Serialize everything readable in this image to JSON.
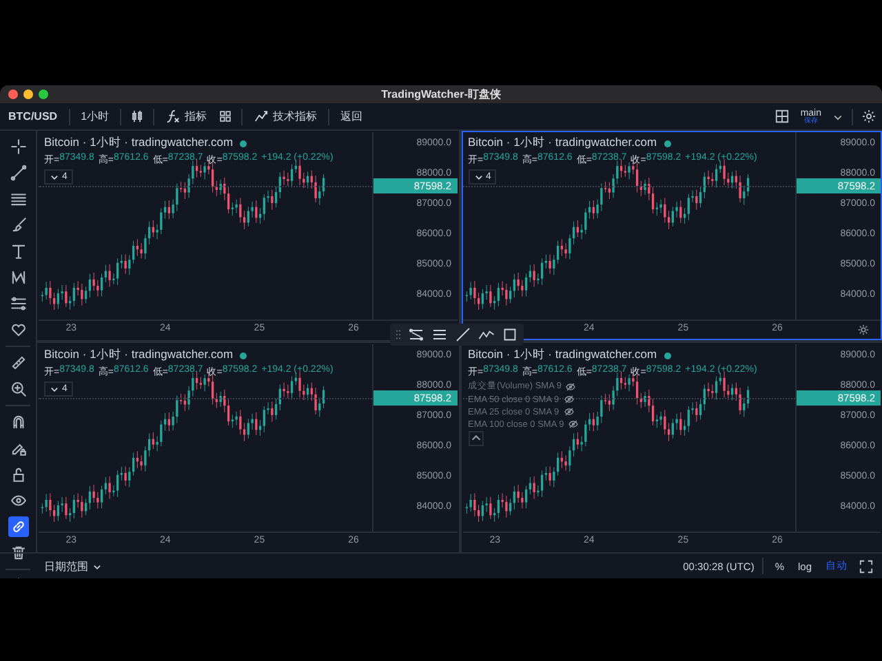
{
  "window": {
    "title": "TradingWatcher-盯盘侠"
  },
  "toolbar": {
    "symbol": "BTC/USD",
    "interval": "1小时",
    "indicators": "指标",
    "technical_indicators": "技术指标",
    "back": "返回",
    "layout_name": "main",
    "layout_status": "保存"
  },
  "link_tool": {
    "on": true
  },
  "panes": [
    {
      "title": "Bitcoin · 1小时 · tradingwatcher.com",
      "selected": false,
      "ohlc": [
        {
          "label": "开=",
          "value": "87349.8"
        },
        {
          "label": "高=",
          "value": "87612.6"
        },
        {
          "label": "低=",
          "value": "87238.7"
        },
        {
          "label": "收=",
          "value": "87598.2"
        }
      ],
      "change": "+194.2 (+0.22%)",
      "collapse_count": "4",
      "y_ticks": [
        "89000.0",
        "88000.0",
        "87000.0",
        "86000.0",
        "85000.0",
        "84000.0"
      ],
      "price_tag": "87598.2",
      "x_ticks": [
        "23",
        "24",
        "25",
        "26"
      ]
    },
    {
      "title": "Bitcoin · 1小时 · tradingwatcher.com",
      "selected": true,
      "ohlc": [
        {
          "label": "开=",
          "value": "87349.8"
        },
        {
          "label": "高=",
          "value": "87612.6"
        },
        {
          "label": "低=",
          "value": "87238.7"
        },
        {
          "label": "收=",
          "value": "87598.2"
        }
      ],
      "change": "+194.2 (+0.22%)",
      "collapse_count": "4",
      "y_ticks": [
        "89000.0",
        "88000.0",
        "87000.0",
        "86000.0",
        "85000.0",
        "84000.0"
      ],
      "price_tag": "87598.2",
      "x_ticks": [
        "24",
        "25",
        "26"
      ]
    },
    {
      "title": "Bitcoin · 1小时 · tradingwatcher.com",
      "selected": false,
      "ohlc": [
        {
          "label": "开=",
          "value": "87349.8"
        },
        {
          "label": "高=",
          "value": "87612.6"
        },
        {
          "label": "低=",
          "value": "87238.7"
        },
        {
          "label": "收=",
          "value": "87598.2"
        }
      ],
      "change": "+194.2 (+0.22%)",
      "collapse_count": "4",
      "y_ticks": [
        "89000.0",
        "88000.0",
        "87000.0",
        "86000.0",
        "85000.0",
        "84000.0"
      ],
      "price_tag": "87598.2",
      "x_ticks": [
        "23",
        "24",
        "25",
        "26"
      ]
    },
    {
      "title": "Bitcoin · 1小时 · tradingwatcher.com",
      "selected": false,
      "ohlc": [
        {
          "label": "开=",
          "value": "87349.8"
        },
        {
          "label": "高=",
          "value": "87612.6"
        },
        {
          "label": "低=",
          "value": "87238.7"
        },
        {
          "label": "收=",
          "value": "87598.2"
        }
      ],
      "change": "+194.2 (+0.22%)",
      "legend": [
        "成交量(Volume) SMA 9",
        "EMA 50 close 0 SMA 9",
        "EMA 25 close 0 SMA 9",
        "EMA 100 close 0 SMA 9"
      ],
      "y_ticks": [
        "89000.0",
        "88000.0",
        "87000.0",
        "86000.0",
        "85000.0",
        "84000.0"
      ],
      "price_tag": "87598.2",
      "x_ticks": [
        "23",
        "24",
        "25",
        "26"
      ]
    }
  ],
  "status_bar": {
    "date_range": "日期范围",
    "clock": "00:30:28 (UTC)",
    "scale_options": [
      {
        "label": "%",
        "selected": false
      },
      {
        "label": "log",
        "selected": false
      },
      {
        "label": "自动",
        "selected": true
      }
    ]
  }
}
